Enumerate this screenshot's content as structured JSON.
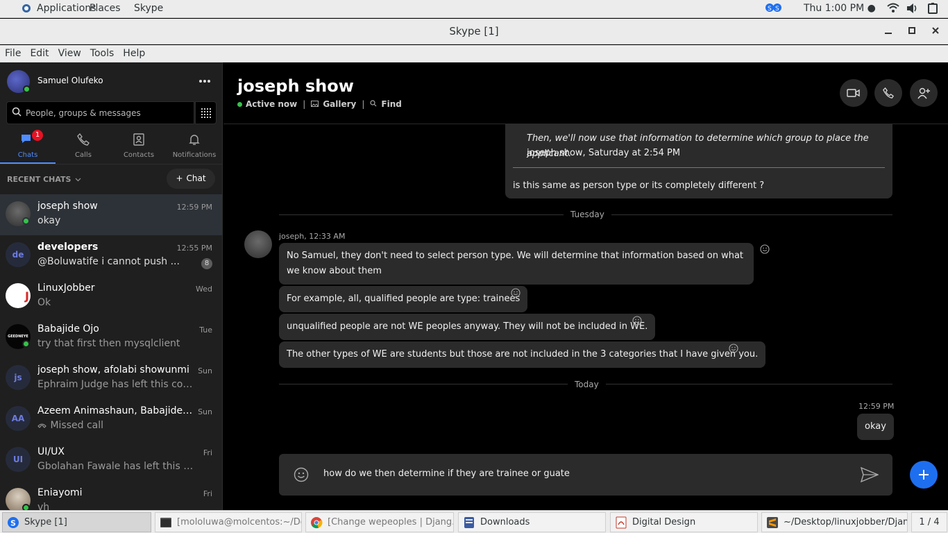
{
  "top_panel": {
    "menus": [
      "Applications",
      "Places",
      "Skype"
    ],
    "clock": "Thu  1:00 PM ●"
  },
  "window": {
    "title": "Skype [1]"
  },
  "menubar": [
    "File",
    "Edit",
    "View",
    "Tools",
    "Help"
  ],
  "profile": {
    "name": "Samuel Olufeko",
    "search_placeholder": "People, groups & messages"
  },
  "nav_tabs": [
    {
      "label": "Chats",
      "badge": "1"
    },
    {
      "label": "Calls"
    },
    {
      "label": "Contacts"
    },
    {
      "label": "Notifications"
    }
  ],
  "recent_chats_label": "RECENT CHATS",
  "new_chat_label": "Chat",
  "chats": [
    {
      "name": "joseph show",
      "preview": "okay",
      "time": "12:59 PM",
      "initials": ""
    },
    {
      "name": "developers",
      "preview": "@Boluwatife  i cannot push ...",
      "time": "12:55 PM",
      "count": "8",
      "initials": "de"
    },
    {
      "name": "LinuxJobber",
      "preview": "Ok",
      "time": "Wed",
      "initials": "J"
    },
    {
      "name": "Babajide Ojo",
      "preview": "try that first then mysqlclient",
      "time": "Tue",
      "initials": "GEEDNEYE"
    },
    {
      "name": "joseph show, afolabi showunmi",
      "preview": "Ephraim Judge has left this conve...",
      "time": "Sun",
      "initials": "js"
    },
    {
      "name": "Azeem Animashaun, Babajide O...",
      "preview": "Missed call",
      "time": "Sun",
      "initials": "AA"
    },
    {
      "name": "UI/UX",
      "preview": "Gbolahan Fawale has left this conv...",
      "time": "Fri",
      "initials": "UI"
    },
    {
      "name": "Eniayomi",
      "preview": "vh",
      "time": "Fri",
      "initials": ""
    }
  ],
  "conversation": {
    "title": "joseph show",
    "status": "Active now",
    "gallery": "Gallery",
    "find": "Find",
    "quote_text": "Then, we'll now use that information to determine which group to place the applicant.",
    "quote_meta": "joseph show, Saturday at 2:54 PM",
    "my_reply_1": "is this same as person type or its completely different ?",
    "day_1": "Tuesday",
    "sender_1": "joseph, 12:33 AM",
    "messages": [
      "No Samuel, they don't need to select person type. We will determine that information based on what we know about them",
      "For example, all, qualified people are type: trainees",
      "unqualified people are not WE peoples anyway. They will not be included in WE.",
      "The other types of WE are students but those are not included in the 3 categories that I have given you."
    ],
    "day_2": "Today",
    "my_time": "12:59 PM",
    "my_reply_2": "okay",
    "compose_text": "how do we then determine if they are trainee or guate"
  },
  "taskbar": {
    "items": [
      "Skype [1]",
      "[mololuwa@molcentos:~/De...",
      "[Change wepeoples | Djang...",
      "Downloads",
      "Digital Design",
      "~/Desktop/linuxjobber/Djan..."
    ],
    "pager": "1 / 4"
  },
  "colors": {
    "accent": "#1e6ff0",
    "presence": "#35c24b",
    "badge": "#e81123"
  }
}
